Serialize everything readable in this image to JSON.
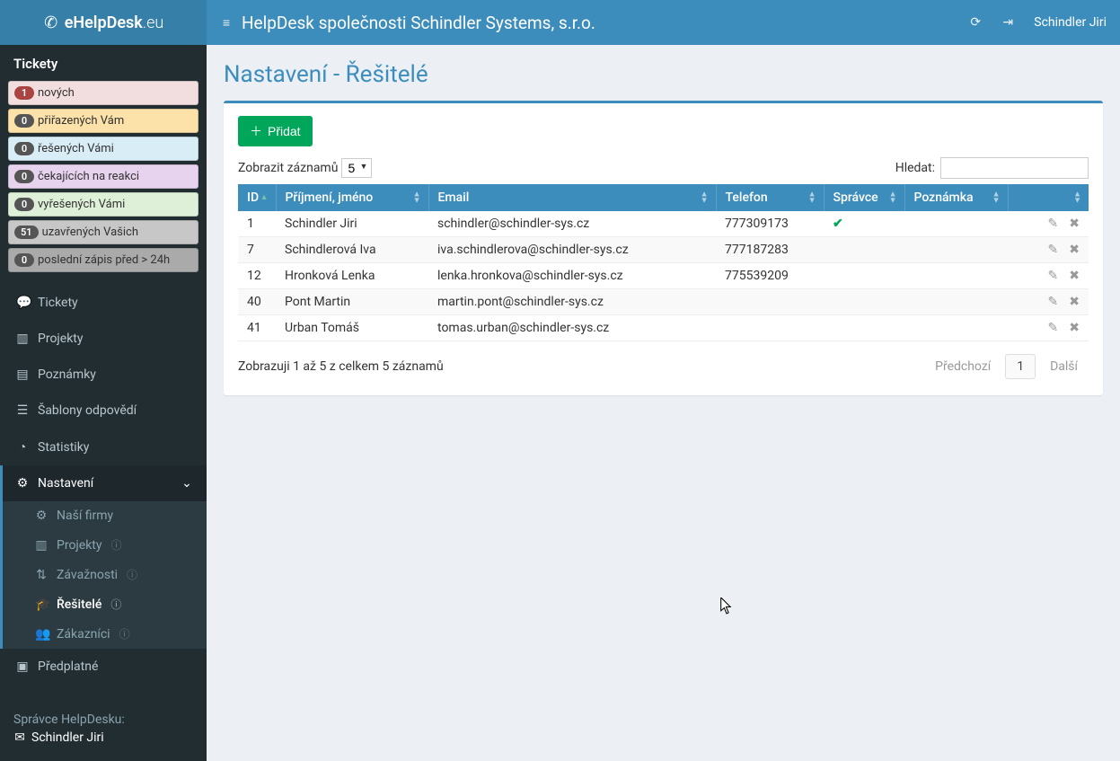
{
  "brand": {
    "prefix": "eHelpDesk",
    "suffix": ".eu"
  },
  "top": {
    "title": "HelpDesk společnosti Schindler Systems, s.r.o.",
    "user": "Schindler Jiri"
  },
  "sidebar": {
    "ticketsHeader": "Tickety",
    "filters": [
      {
        "count": "1",
        "label": "nových",
        "cls": "fp-red"
      },
      {
        "count": "0",
        "label": "přiřazených Vám",
        "cls": "fp-orange"
      },
      {
        "count": "0",
        "label": "řešených Vámi",
        "cls": "fp-blue"
      },
      {
        "count": "0",
        "label": "čekajících na reakci",
        "cls": "fp-purple"
      },
      {
        "count": "0",
        "label": "vyřešených Vámi",
        "cls": "fp-green"
      },
      {
        "count": "51",
        "label": "uzavřených Vašich",
        "cls": "fp-gray"
      },
      {
        "count": "0",
        "label": "poslední zápis před > 24h",
        "cls": "fp-dark"
      }
    ],
    "nav": {
      "tickety": "Tickety",
      "projekty": "Projekty",
      "poznamky": "Poznámky",
      "sablony": "Šablony odpovědí",
      "statistiky": "Statistiky",
      "nastaveni": "Nastavení",
      "predplatne": "Předplatné"
    },
    "settingsSub": [
      {
        "label": "Naší firmy",
        "info": false
      },
      {
        "label": "Projekty",
        "info": true
      },
      {
        "label": "Závažnosti",
        "info": true
      },
      {
        "label": "Řešitelé",
        "info": true,
        "active": true
      },
      {
        "label": "Zákazníci",
        "info": true
      }
    ],
    "footer": {
      "title": "Správce HelpDesku:",
      "name": "Schindler Jiri"
    }
  },
  "page": {
    "title": "Nastavení - Řešitelé",
    "addBtn": "Přidat",
    "lenLabel": "Zobrazit záznamů",
    "lenValue": "5",
    "searchLabel": "Hledat:",
    "columns": {
      "id": "ID",
      "name": "Příjmení, jméno",
      "email": "Email",
      "phone": "Telefon",
      "admin": "Správce",
      "note": "Poznámka"
    },
    "rows": [
      {
        "id": "1",
        "name": "Schindler Jiri",
        "email": "schindler@schindler-sys.cz",
        "phone": "777309173",
        "admin": true
      },
      {
        "id": "7",
        "name": "Schindlerová Iva",
        "email": "iva.schindlerova@schindler-sys.cz",
        "phone": "777187283",
        "admin": false
      },
      {
        "id": "12",
        "name": "Hronková Lenka",
        "email": "lenka.hronkova@schindler-sys.cz",
        "phone": "775539209",
        "admin": false
      },
      {
        "id": "40",
        "name": "Pont Martin",
        "email": "martin.pont@schindler-sys.cz",
        "phone": "",
        "admin": false
      },
      {
        "id": "41",
        "name": "Urban Tomáš",
        "email": "tomas.urban@schindler-sys.cz",
        "phone": "",
        "admin": false
      }
    ],
    "footerInfo": "Zobrazuji 1 až 5 z celkem 5 záznamů",
    "pager": {
      "prev": "Předchozí",
      "page": "1",
      "next": "Další"
    }
  }
}
